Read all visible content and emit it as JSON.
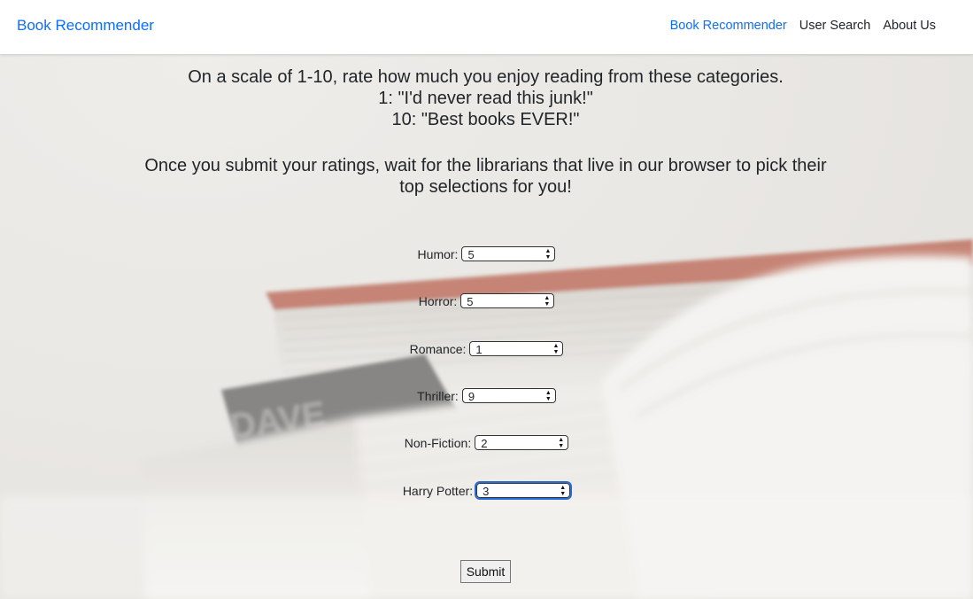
{
  "navbar": {
    "brand": "Book Recommender",
    "links": [
      {
        "label": "Book Recommender",
        "active": true
      },
      {
        "label": "User Search",
        "active": false
      },
      {
        "label": "About Us",
        "active": false
      }
    ]
  },
  "intro": {
    "line1": "On a scale of 1-10, rate how much you enjoy reading from these categories.",
    "line2": "1: \"I'd never read this junk!\"",
    "line3": "10: \"Best books EVER!\"",
    "line4": "Once you submit your ratings, wait for the librarians that live in our browser to pick their top selections for you!"
  },
  "form": {
    "ratings": [
      {
        "label": "Humor:",
        "value": "5"
      },
      {
        "label": "Horror:",
        "value": "5"
      },
      {
        "label": "Romance:",
        "value": "1"
      },
      {
        "label": "Thriller:",
        "value": "9"
      },
      {
        "label": "Non-Fiction:",
        "value": "2"
      },
      {
        "label": "Harry Potter:",
        "value": "3",
        "focused": true
      }
    ],
    "submit_label": "Submit"
  },
  "colors": {
    "brand": "#0d6efd",
    "text": "#212529",
    "focus": "#2b6cd4"
  }
}
